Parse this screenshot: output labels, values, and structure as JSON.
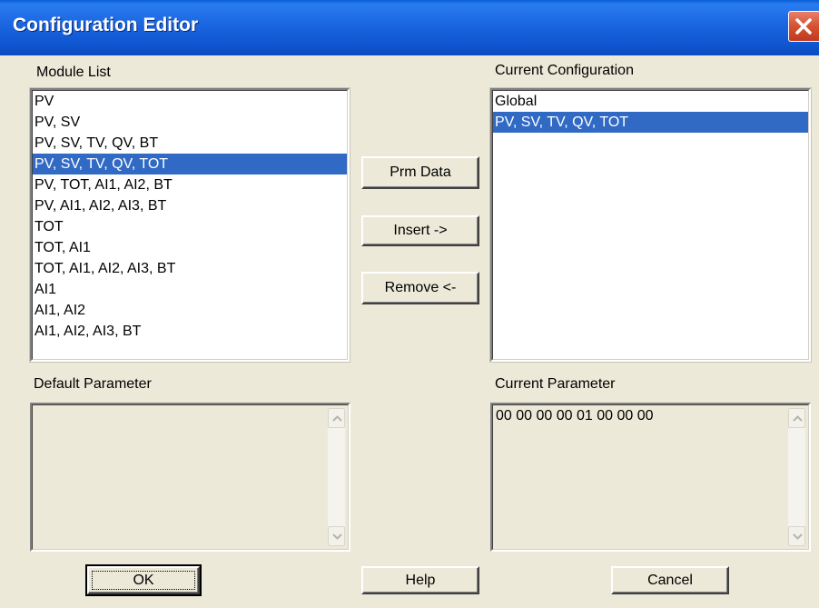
{
  "window": {
    "title": "Configuration Editor"
  },
  "labels": {
    "module_list": "Module List",
    "current_configuration": "Current Configuration",
    "default_parameter": "Default Parameter",
    "current_parameter": "Current Parameter"
  },
  "module_list": {
    "items": [
      "PV",
      "PV, SV",
      "PV, SV, TV, QV, BT",
      "PV, SV, TV, QV, TOT",
      "PV, TOT, AI1, AI2, BT",
      "PV, AI1, AI2, AI3, BT",
      "TOT",
      "TOT, AI1",
      "TOT, AI1, AI2, AI3, BT",
      "AI1",
      "AI1, AI2",
      "AI1, AI2, AI3, BT"
    ],
    "selected": "PV, SV, TV, QV, TOT"
  },
  "current_configuration": {
    "items": [
      "Global",
      "PV, SV, TV, QV, TOT"
    ],
    "selected": "PV, SV, TV, QV, TOT"
  },
  "default_parameter": {
    "value": ""
  },
  "current_parameter": {
    "value": "00 00 00 00 01 00 00 00"
  },
  "buttons": {
    "prm_data": "Prm Data",
    "insert": "Insert ->",
    "remove": "Remove <-",
    "ok": "OK",
    "help": "Help",
    "cancel": "Cancel"
  },
  "icons": {
    "close": "close-icon",
    "scroll_up": "scroll-up-arrow-icon",
    "scroll_down": "scroll-down-arrow-icon"
  },
  "colors": {
    "titlebar": "#0a5fd6",
    "selection": "#316ac5",
    "dialog_bg": "#ece9d8",
    "close_button": "#d45232"
  }
}
